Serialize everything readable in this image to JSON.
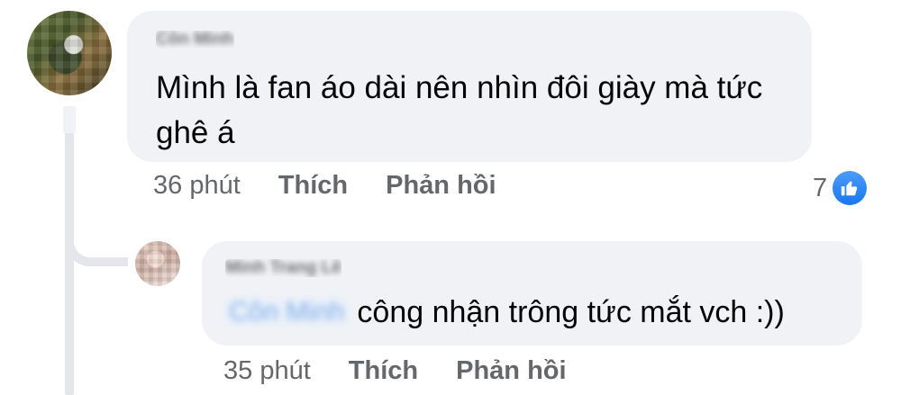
{
  "comments": [
    {
      "author": "Côn Minh",
      "text": "Mình là fan áo dài nên nhìn đôi giày mà tức ghê á",
      "time": "36 phút",
      "like_label": "Thích",
      "reply_label": "Phản hồi",
      "reaction_count": "7",
      "reaction_icon": "like-icon",
      "accent_color": "#1877f2"
    },
    {
      "author": "Minh Trang Lê",
      "mention": "Côn Minh",
      "text": "công nhận trông tức mắt vch :))",
      "time": "35 phút",
      "like_label": "Thích",
      "reply_label": "Phản hồi"
    }
  ]
}
